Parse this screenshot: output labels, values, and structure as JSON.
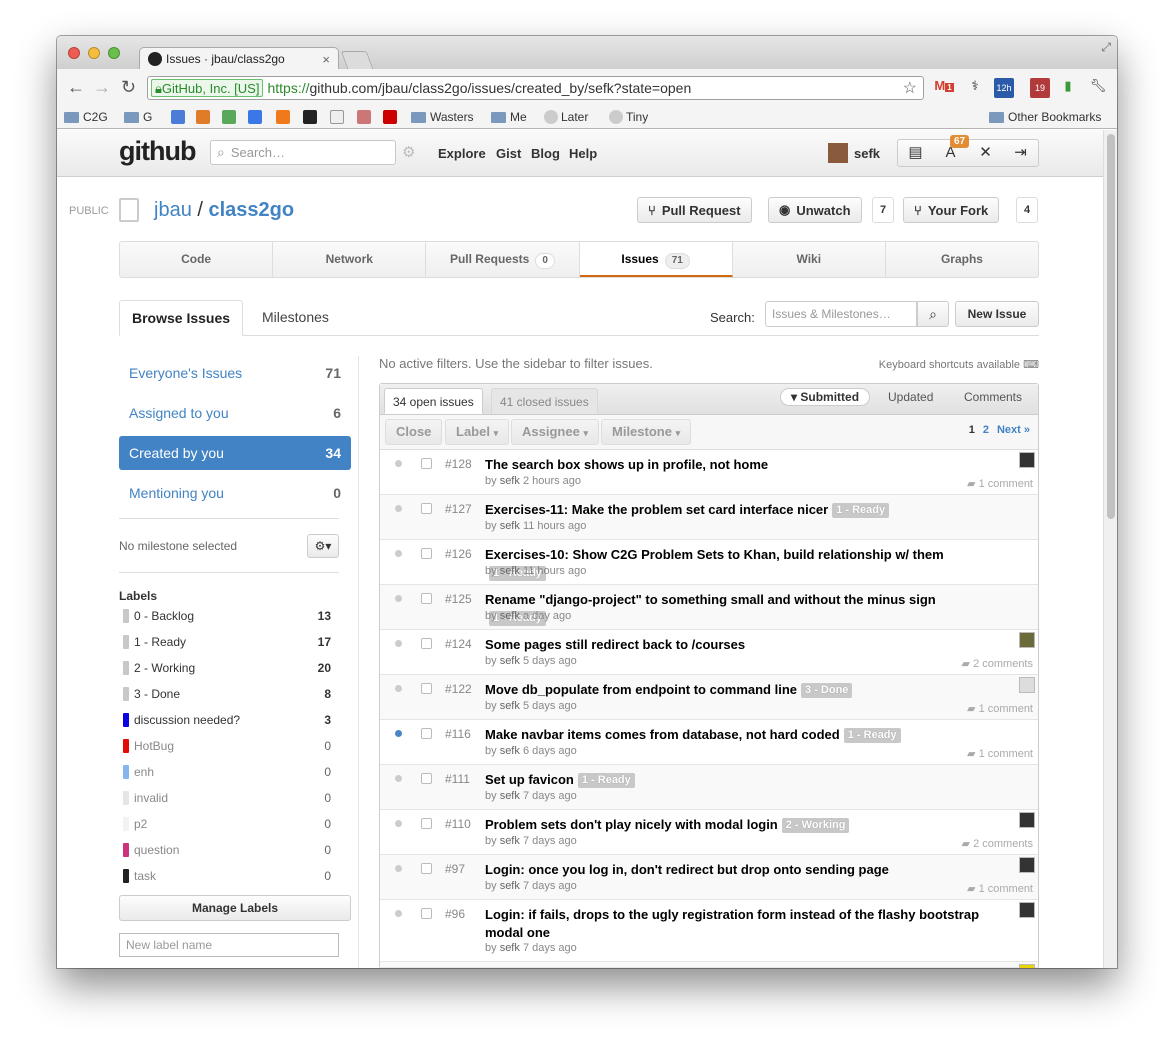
{
  "browser": {
    "tab_title": "Issues · jbau/class2go",
    "ssl_label": "GitHub, Inc. [US]",
    "url_https": "https://",
    "url_rest": "github.com/jbau/class2go/issues/created_by/sefk?state=open",
    "ext_badges": {
      "gmail": "1",
      "cal": "12h",
      "todo": "19"
    },
    "bookmarks": [
      "C2G",
      "G",
      "Wasters",
      "Me",
      "Later",
      "Tiny"
    ],
    "other_bookmarks": "Other Bookmarks"
  },
  "header": {
    "logo": "github",
    "search_placeholder": "Search…",
    "nav": [
      "Explore",
      "Gist",
      "Blog",
      "Help"
    ],
    "username": "sefk",
    "notifications": "67"
  },
  "repo": {
    "visibility": "PUBLIC",
    "owner": "jbau",
    "sep": " / ",
    "name": "class2go",
    "pull_request_label": "Pull Request",
    "unwatch_label": "Unwatch",
    "watch_count": "7",
    "fork_label": "Your Fork",
    "fork_count": "4"
  },
  "tabs": [
    {
      "label": "Code"
    },
    {
      "label": "Network"
    },
    {
      "label": "Pull Requests",
      "count": "0"
    },
    {
      "label": "Issues",
      "count": "71"
    },
    {
      "label": "Wiki"
    },
    {
      "label": "Graphs"
    }
  ],
  "subtabs": {
    "browse": "Browse Issues",
    "milestones": "Milestones",
    "search_label": "Search:",
    "search_placeholder": "Issues & Milestones…",
    "new_issue": "New Issue"
  },
  "sidebar": {
    "filters": [
      {
        "label": "Everyone's Issues",
        "count": "71"
      },
      {
        "label": "Assigned to you",
        "count": "6"
      },
      {
        "label": "Created by you",
        "count": "34"
      },
      {
        "label": "Mentioning you",
        "count": "0"
      }
    ],
    "milestone": "No milestone selected",
    "labels_heading": "Labels",
    "labels": [
      {
        "name": "0 - Backlog",
        "count": "13",
        "color": "#c8c8c8"
      },
      {
        "name": "1 - Ready",
        "count": "17",
        "color": "#c8c8c8"
      },
      {
        "name": "2 - Working",
        "count": "20",
        "color": "#c8c8c8"
      },
      {
        "name": "3 - Done",
        "count": "8",
        "color": "#c8c8c8"
      },
      {
        "name": "discussion needed?",
        "count": "3",
        "color": "#0b02e1"
      },
      {
        "name": "HotBug",
        "count": "0",
        "color": "#e10c02"
      },
      {
        "name": "enh",
        "count": "0",
        "color": "#84b6eb"
      },
      {
        "name": "invalid",
        "count": "0",
        "color": "#e6e6e6"
      },
      {
        "name": "p2",
        "count": "0",
        "color": "#f3f3f3"
      },
      {
        "name": "question",
        "count": "0",
        "color": "#cc317c"
      },
      {
        "name": "task",
        "count": "0",
        "color": "#222222"
      }
    ],
    "manage_labels": "Manage Labels",
    "new_label_placeholder": "New label name"
  },
  "issues_panel": {
    "no_filters": "No active filters. Use the sidebar to filter issues.",
    "kbd_hint": "Keyboard shortcuts available",
    "open_tab": "34 open issues",
    "closed_tab": "41 closed issues",
    "sort": [
      "Submitted",
      "Updated",
      "Comments"
    ],
    "actions": [
      "Close",
      "Label",
      "Assignee",
      "Milestone"
    ],
    "pager": {
      "current": "1",
      "page2": "2",
      "next": "Next »"
    },
    "issues": [
      {
        "num": "#128",
        "title": "The search box shows up in profile, not home",
        "label": "",
        "by": "by",
        "user": "sefk",
        "age": "2 hours ago",
        "comments": "1 comment"
      },
      {
        "num": "#127",
        "title": "Exercises-11: Make the problem set card interface nicer",
        "label": "1 - Ready",
        "by": "by",
        "user": "sefk",
        "age": "11 hours ago",
        "comments": ""
      },
      {
        "num": "#126",
        "title": "Exercises-10: Show C2G Problem Sets to Khan, build relationship w/ them",
        "label": "1 - Ready",
        "by": "by",
        "user": "sefk",
        "age": "11 hours ago",
        "comments": ""
      },
      {
        "num": "#125",
        "title": "Rename \"django-project\" to something small and without the minus sign",
        "label": "1 - Ready",
        "by": "by",
        "user": "sefk",
        "age": "a day ago",
        "comments": ""
      },
      {
        "num": "#124",
        "title": "Some pages still redirect back to /courses",
        "label": "",
        "by": "by",
        "user": "sefk",
        "age": "5 days ago",
        "comments": "2 comments"
      },
      {
        "num": "#122",
        "title": "Move db_populate from endpoint to command line",
        "label": "3 - Done",
        "by": "by",
        "user": "sefk",
        "age": "5 days ago",
        "comments": "1 comment"
      },
      {
        "num": "#116",
        "title": "Make navbar items comes from database, not hard coded",
        "label": "1 - Ready",
        "by": "by",
        "user": "sefk",
        "age": "6 days ago",
        "comments": "1 comment"
      },
      {
        "num": "#111",
        "title": "Set up favicon",
        "label": "1 - Ready",
        "by": "by",
        "user": "sefk",
        "age": "7 days ago",
        "comments": ""
      },
      {
        "num": "#110",
        "title": "Problem sets don't play nicely with modal login",
        "label": "2 - Working",
        "by": "by",
        "user": "sefk",
        "age": "7 days ago",
        "comments": "2 comments"
      },
      {
        "num": "#97",
        "title": "Login: once you log in, don't redirect but drop onto sending page",
        "label": "",
        "by": "by",
        "user": "sefk",
        "age": "7 days ago",
        "comments": "1 comment"
      },
      {
        "num": "#96",
        "title": "Login: if fails, drops to the ugly registration form instead of the flashy bootstrap modal one",
        "label": "",
        "by": "by",
        "user": "sefk",
        "age": "7 days ago",
        "comments": ""
      }
    ]
  }
}
